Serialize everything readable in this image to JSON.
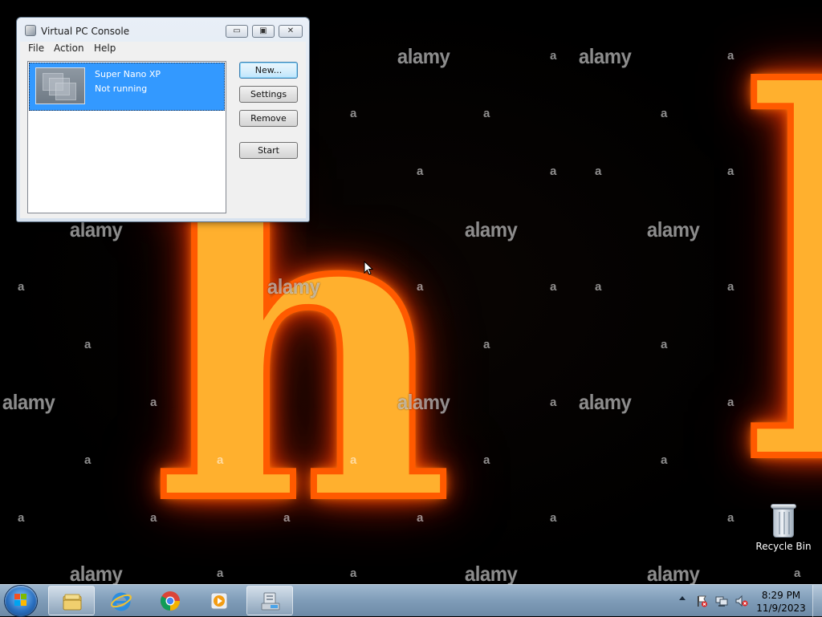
{
  "wallpaper": {
    "glyphs": [
      "h",
      "l"
    ],
    "watermark_text": "alamy",
    "watermark_letter": "a"
  },
  "desktop": {
    "recycle_bin": {
      "label": "Recycle Bin",
      "icon": "recycle-bin-icon"
    }
  },
  "window": {
    "title": "Virtual PC Console",
    "icon": "virtual-pc-icon",
    "controls": {
      "minimize": "▭",
      "maximize": "▣",
      "close": "✕"
    },
    "menu": [
      "File",
      "Action",
      "Help"
    ],
    "vm_list": [
      {
        "name": "Super Nano XP",
        "status": "Not running",
        "selected": true
      }
    ],
    "buttons": {
      "new": "New...",
      "settings": "Settings",
      "remove": "Remove",
      "start": "Start"
    }
  },
  "taskbar": {
    "start_icon": "windows-start-icon",
    "pinned": [
      {
        "name": "windows-explorer",
        "icon": "folder-icon",
        "active": true
      },
      {
        "name": "internet-explorer",
        "icon": "ie-icon",
        "active": false
      },
      {
        "name": "chrome",
        "icon": "chrome-icon",
        "active": false
      },
      {
        "name": "media-player",
        "icon": "media-player-icon",
        "active": false
      },
      {
        "name": "virtual-pc-console",
        "icon": "virtual-pc-icon",
        "active": true
      }
    ],
    "tray": {
      "icons": [
        "show-hidden-icons-arrow",
        "action-center-flag-icon",
        "network-icon",
        "volume-muted-icon"
      ],
      "time": "8:29 PM",
      "date": "11/9/2023"
    }
  },
  "colors": {
    "selection": "#3399ff",
    "taskbar": "#7f9cb8",
    "fire": "#ff7a00"
  }
}
